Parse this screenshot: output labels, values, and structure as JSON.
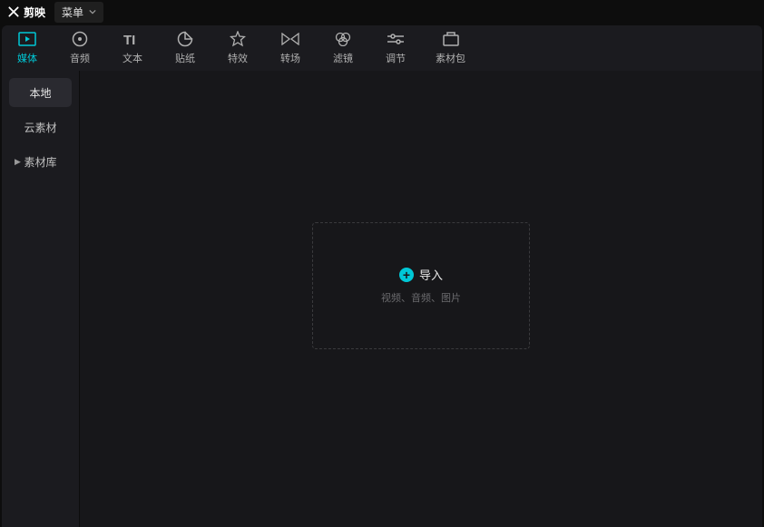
{
  "brand": {
    "name": "剪映"
  },
  "menu": {
    "label": "菜单"
  },
  "toolbar": [
    {
      "id": "media",
      "label": "媒体",
      "active": true
    },
    {
      "id": "audio",
      "label": "音频",
      "active": false
    },
    {
      "id": "text",
      "label": "文本",
      "active": false
    },
    {
      "id": "sticker",
      "label": "贴纸",
      "active": false
    },
    {
      "id": "effect",
      "label": "特效",
      "active": false
    },
    {
      "id": "transition",
      "label": "转场",
      "active": false
    },
    {
      "id": "filter",
      "label": "滤镜",
      "active": false
    },
    {
      "id": "adjust",
      "label": "调节",
      "active": false
    },
    {
      "id": "assetpack",
      "label": "素材包",
      "active": false
    }
  ],
  "sidebar": [
    {
      "id": "local",
      "label": "本地",
      "active": true,
      "expandable": false
    },
    {
      "id": "cloud",
      "label": "云素材",
      "active": false,
      "expandable": false
    },
    {
      "id": "library",
      "label": "素材库",
      "active": false,
      "expandable": true
    }
  ],
  "import": {
    "label": "导入",
    "hint": "视频、音频、图片"
  }
}
